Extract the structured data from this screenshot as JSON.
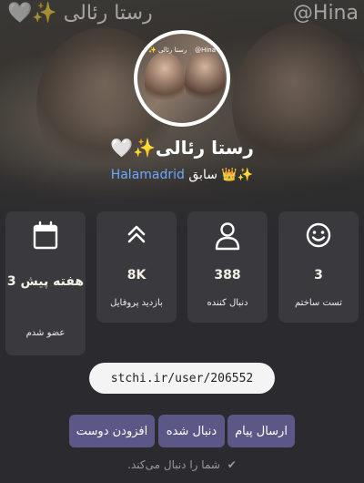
{
  "cover": {
    "text_left": "رستا رئالی ✨🤍",
    "text_right": "@Hina"
  },
  "avatar": {
    "text_left": "رستا رئالی ✨",
    "text_right": "@Hina"
  },
  "profile": {
    "name": "رستا رئالی✨🤍",
    "subtitle_link": "Halamadrid",
    "subtitle_rest": "سابق",
    "subtitle_emoji": "✨👑"
  },
  "stats": {
    "tests": {
      "value": "3",
      "label": "تست ساختم",
      "icon": "smiley-icon"
    },
    "followers": {
      "value": "388",
      "label": "دنبال کننده",
      "icon": "user-icon"
    },
    "visits": {
      "value": "8K",
      "label": "بازدید پروفایل",
      "icon": "double-chevron-up-icon"
    },
    "member": {
      "value": "3 هفته پیش",
      "label": "عضو شدم",
      "icon": "calendar-icon"
    }
  },
  "profile_url": "stchi.ir/user/206552",
  "buttons": {
    "send_message": "ارسال پیام",
    "following": "دنبال شده",
    "add_friend": "افزودن دوست"
  },
  "following_note": "شما را دنبال می‌کند.",
  "colors": {
    "background": "#2b2b2f",
    "card": "#3a3a3e",
    "button": "#5b5888",
    "link": "#6ea8ff"
  }
}
